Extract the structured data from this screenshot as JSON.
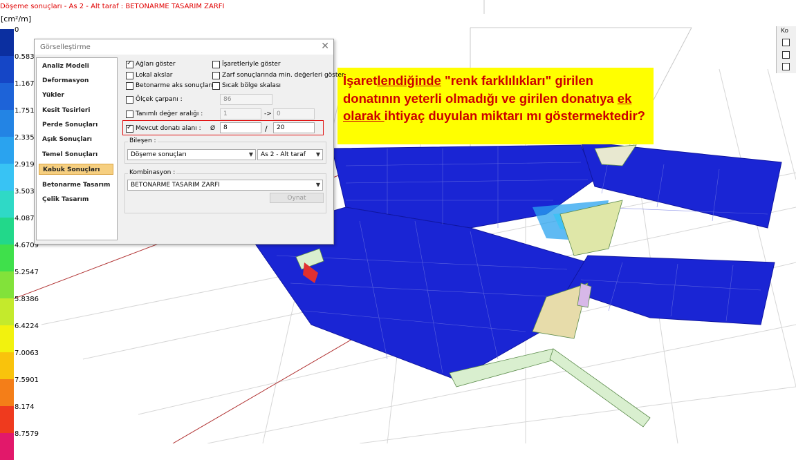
{
  "viewport": {
    "title": "Döşeme sonuçları - As 2 - Alt taraf : BETONARME TASARIM ZARFI",
    "unit": "[cm²/m]"
  },
  "legend": {
    "values": [
      "0",
      "0.5839",
      "1.1677",
      "1.7516",
      "2.3354",
      "2.9193",
      "3.5031",
      "4.087",
      "4.6709",
      "5.2547",
      "5.8386",
      "6.4224",
      "7.0063",
      "7.5901",
      "8.174",
      "8.7579"
    ],
    "colors": [
      "#0b2fa0",
      "#1546c6",
      "#1d63d8",
      "#2384e4",
      "#2aa3ef",
      "#38c3f4",
      "#2fd9c6",
      "#22d88a",
      "#3fe04b",
      "#82e23a",
      "#c4ea2c",
      "#f2f20e",
      "#f9c30c",
      "#f47e18",
      "#ef3a1e",
      "#e2186a"
    ]
  },
  "dialog": {
    "title": "Görselleştirme",
    "close": "✕",
    "nav": [
      {
        "label": "Analiz Modeli",
        "selected": false
      },
      {
        "label": "Deformasyon",
        "selected": false
      },
      {
        "label": "Yükler",
        "selected": false
      },
      {
        "label": "Kesit Tesirleri",
        "selected": false
      },
      {
        "label": "Perde Sonuçları",
        "selected": false
      },
      {
        "label": "Aşık Sonuçları",
        "selected": false
      },
      {
        "label": "Temel Sonuçları",
        "selected": false
      },
      {
        "label": "Kabuk Sonuçları",
        "selected": true
      },
      {
        "label": "Betonarme Tasarım",
        "selected": false
      },
      {
        "label": "Çelik Tasarım",
        "selected": false
      }
    ],
    "options": {
      "aglari_goster": {
        "label": "Ağları göster",
        "checked": true
      },
      "isaretleriyle_goster": {
        "label": "İşaretleriyle göster",
        "checked": false
      },
      "lokal_akslar": {
        "label": "Lokal akslar",
        "checked": false
      },
      "zarf_min": {
        "label": "Zarf sonuçlarında min. değerleri göster",
        "checked": false
      },
      "betonarme_aks": {
        "label": "Betonarme aks sonuçları",
        "checked": false
      },
      "sicak_bolge": {
        "label": "Sıcak bölge skalası",
        "checked": false
      },
      "olcek_carpani": {
        "label": "Ölçek çarpanı :",
        "checked": false,
        "value": "86"
      },
      "tanimli_deger": {
        "label": "Tanımlı değer aralığı :",
        "checked": false,
        "from": "1",
        "arrow": "->",
        "to": "0"
      },
      "mevcut_donati": {
        "label": "Mevcut donatı alanı :",
        "checked": true,
        "phi": "Ø",
        "diameter": "8",
        "slash": "/",
        "spacing": "20"
      }
    },
    "bilesen": {
      "label": "Bileşen :",
      "component": "Döşeme sonuçları",
      "side": "As 2 - Alt taraf"
    },
    "kombinasyon": {
      "label": "Kombinasyon :",
      "value": "BETONARME TASARIM ZARFI"
    },
    "play_button": "Oynat"
  },
  "note": {
    "parts": [
      {
        "text": "İşaret",
        "u": false
      },
      {
        "text": "lendiğinde",
        "u": true
      },
      {
        "text": "  \"renk farklılıkları\"  girilen donatının yeterli olmadığı ve girilen donatıya ",
        "u": false
      },
      {
        "text": "ek olarak ",
        "u": true
      },
      {
        "text": "ihtiyaç duyulan miktarı mı göstermektedir?",
        "u": false
      }
    ]
  },
  "right_panel": {
    "label": "Ko"
  }
}
